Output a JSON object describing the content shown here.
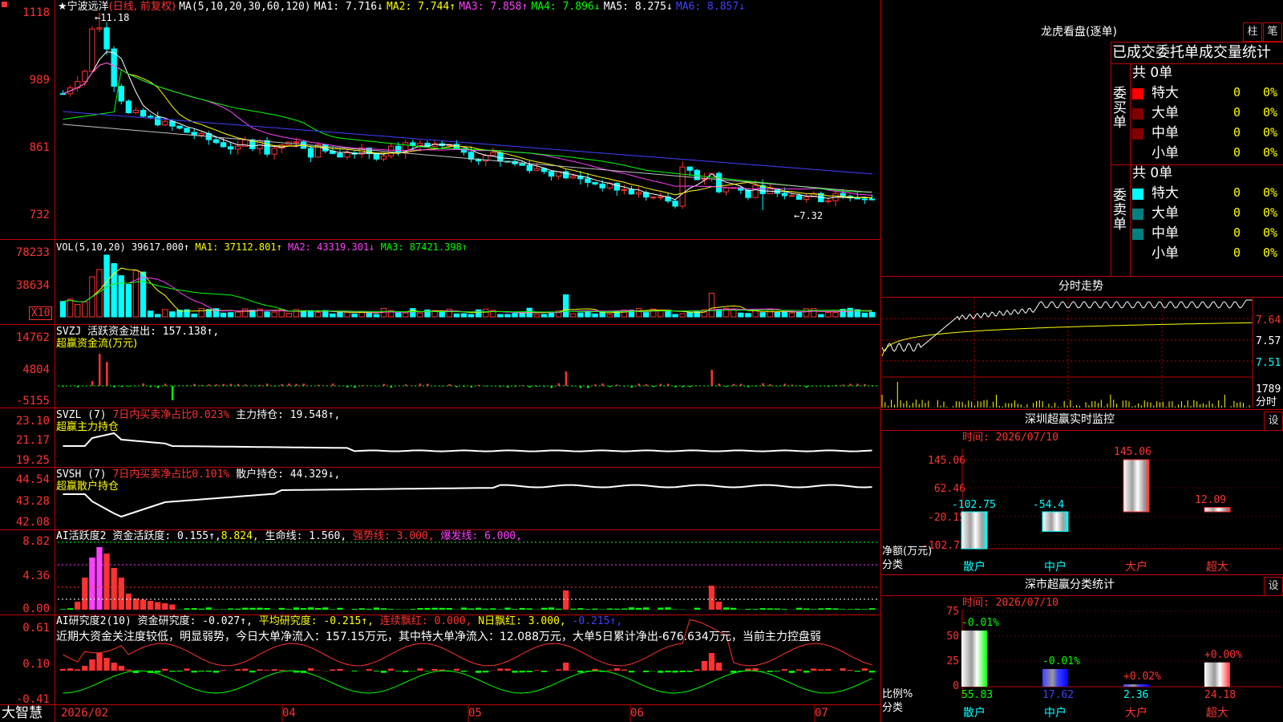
{
  "stock": {
    "star": "★",
    "name": "宁波远洋",
    "period": "(日线, 前复权)"
  },
  "ma": {
    "prefix": "MA(5,10,20,30,60,120)",
    "ma1": "MA1: 7.716↓",
    "ma2": "MA2: 7.744↑",
    "ma3": "MA3: 7.858↑",
    "ma4": "MA4: 7.896↓",
    "ma5": "MA5: 8.275↓",
    "ma6": "MA6: 8.857↓"
  },
  "price_axis": [
    "1118",
    "989",
    "861",
    "732"
  ],
  "price_marks": {
    "high": "11.18",
    "low": "←7.32"
  },
  "vol": {
    "header": "VOL(5,10,20)",
    "v": "39617.000↑",
    "ma1": "MA1: 37112.801↑",
    "ma2": "MA2: 43319.301↓",
    "ma3": "MA3: 87421.398↑",
    "axis": [
      "78233",
      "38634"
    ],
    "unit": "X10"
  },
  "svzj": {
    "name": "SVZJ",
    "label": "活跃资金进出: 157.138↑,",
    "title": "超赢资金流(万元)",
    "axis": [
      "14762",
      "4804",
      "-5155"
    ]
  },
  "svzl": {
    "name": "SVZL (7)",
    "net": "7日内买卖净占比0.023%",
    "hold": "主力持仓: 19.548↑,",
    "title": "超赢主力持仓",
    "axis": [
      "23.10",
      "21.17",
      "19.25"
    ]
  },
  "svsh": {
    "name": "SVSH (7)",
    "net": "7日内买卖净占比0.101%",
    "hold": "散户持仓: 44.329↓,",
    "title": "超赢散户持仓",
    "axis": [
      "44.54",
      "43.28",
      "42.08"
    ]
  },
  "ai_active": {
    "name": "AI活跃度2",
    "a": "资金活跃度: 0.155↑,",
    "b": "8.824,",
    "c": "生命线: 1.560,",
    "d": "强势线: 3.000,",
    "e": "爆发线: 6.000,",
    "axis": [
      "8.82",
      "4.36",
      "0.00"
    ]
  },
  "ai_research": {
    "name": "AI研究度2(10)",
    "a": "资金研究度: -0.027↑,",
    "b": "平均研究度: -0.215↑,",
    "c": "连续飘红: 0.000,",
    "d": "N日飘红: 3.000,",
    "e": "-0.215↑,",
    "text": "近期大资金关注度较低，明显弱势，今日大单净流入：157.15万元，其中特大单净流入：12.088万元，大单5日累计净出-676.634万元，当前主力控盘弱",
    "axis": [
      "0.61",
      "0.10",
      "-0.41"
    ]
  },
  "time_axis": [
    "2026/02",
    "04",
    "05",
    "06",
    "07"
  ],
  "brand": "大智慧",
  "lhkp": {
    "title": "龙虎看盘(逐单)",
    "btn1": "柱",
    "btn2": "笔",
    "header": "已成交委托单成交量统计",
    "buy_label": "委买单",
    "sell_label": "委卖单",
    "buy_total": "共 0单",
    "sell_total": "共 0单",
    "buy_rows": [
      {
        "label": "特大",
        "qty": "0",
        "pct": "0%"
      },
      {
        "label": "大单",
        "qty": "0",
        "pct": "0%"
      },
      {
        "label": "中单",
        "qty": "0",
        "pct": "0%"
      },
      {
        "label": "小单",
        "qty": "0",
        "pct": "0%"
      }
    ],
    "sell_rows": [
      {
        "label": "特大",
        "qty": "0",
        "pct": "0%"
      },
      {
        "label": "大单",
        "qty": "0",
        "pct": "0%"
      },
      {
        "label": "中单",
        "qty": "0",
        "pct": "0%"
      },
      {
        "label": "小单",
        "qty": "0",
        "pct": "0%"
      }
    ]
  },
  "fenshi": {
    "title": "分时走势",
    "axis": [
      "7.64",
      "7.57",
      "7.51"
    ],
    "vol_top": "1789",
    "vol_label": "分时"
  },
  "monitor": {
    "title": "深圳超赢实时监控",
    "btn": "设",
    "time": "时间: 2026/07/10",
    "axis": [
      "145.06",
      "62.46",
      "-20.15",
      "-102.75"
    ],
    "ylabel": "净额(万元)",
    "xlabel": "分类",
    "categories": [
      "散户",
      "中户",
      "大户",
      "超大"
    ],
    "values": [
      -102.75,
      -54.4,
      145.06,
      12.09
    ],
    "value_labels": [
      "-102.75",
      "-54.4",
      "145.06",
      "12.09"
    ]
  },
  "classify": {
    "title": "深市超赢分类统计",
    "btn": "设",
    "time": "时间: 2026/07/10",
    "axis": [
      "75",
      "50",
      "25",
      "0"
    ],
    "ylabel": "比例%",
    "xlabel": "分类",
    "categories": [
      "散户",
      "中户",
      "大户",
      "超大"
    ],
    "values": [
      55.83,
      17.62,
      2.36,
      24.18
    ],
    "value_labels": [
      "55.83",
      "17.62",
      "2.36",
      "24.18"
    ],
    "changes": [
      "-0.01%",
      "-0.01%",
      "+0.02%",
      "+0.00%"
    ]
  },
  "colors": {
    "up": "#ff3232",
    "down": "#00ffff",
    "grid": "#c00000"
  }
}
